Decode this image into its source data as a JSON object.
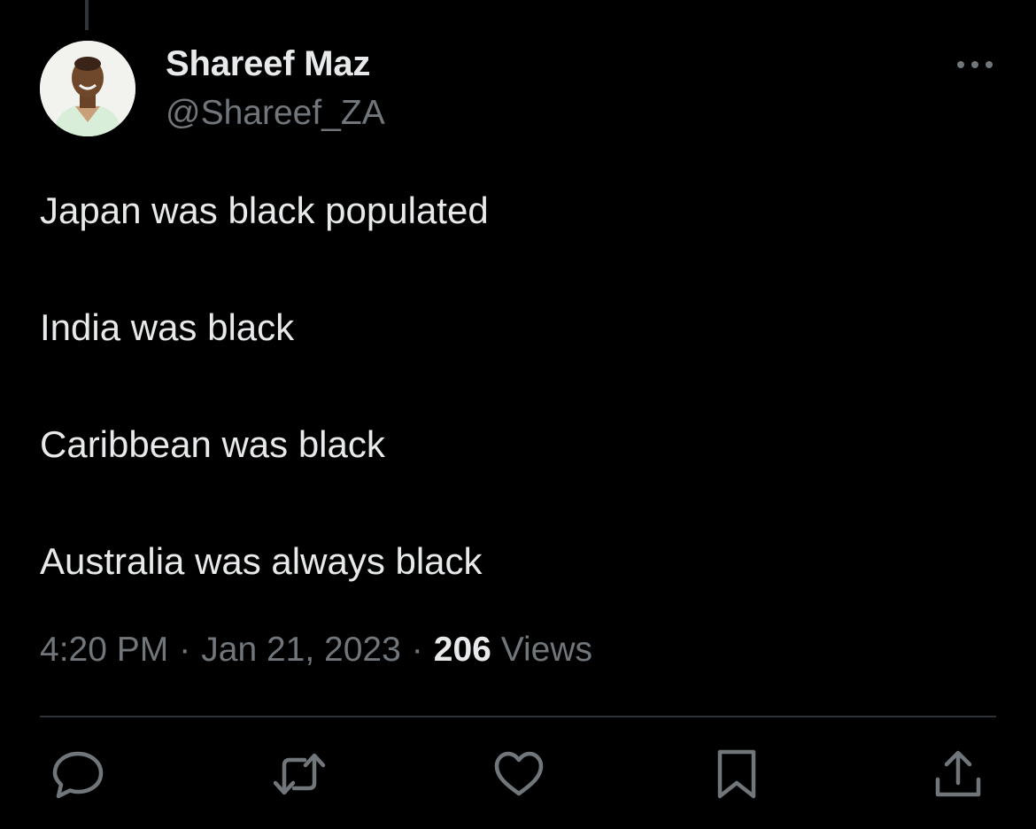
{
  "author": {
    "display_name": "Shareef Maz",
    "handle": "@Shareef_ZA",
    "avatar_icon": "profile-photo"
  },
  "tweet": {
    "lines": [
      "Japan was black populated",
      "India was black",
      "Caribbean was black",
      "Australia was always black"
    ],
    "time": "4:20 PM",
    "date": "Jan 21, 2023",
    "views_count": "206",
    "views_label": "Views"
  },
  "actions": [
    {
      "icon": "reply-icon"
    },
    {
      "icon": "retweet-icon"
    },
    {
      "icon": "like-icon"
    },
    {
      "icon": "bookmark-icon"
    },
    {
      "icon": "share-icon"
    }
  ],
  "colors": {
    "background": "#000000",
    "primary_text": "#e7e9ea",
    "secondary_text": "#71767b",
    "divider": "#2f3336"
  }
}
